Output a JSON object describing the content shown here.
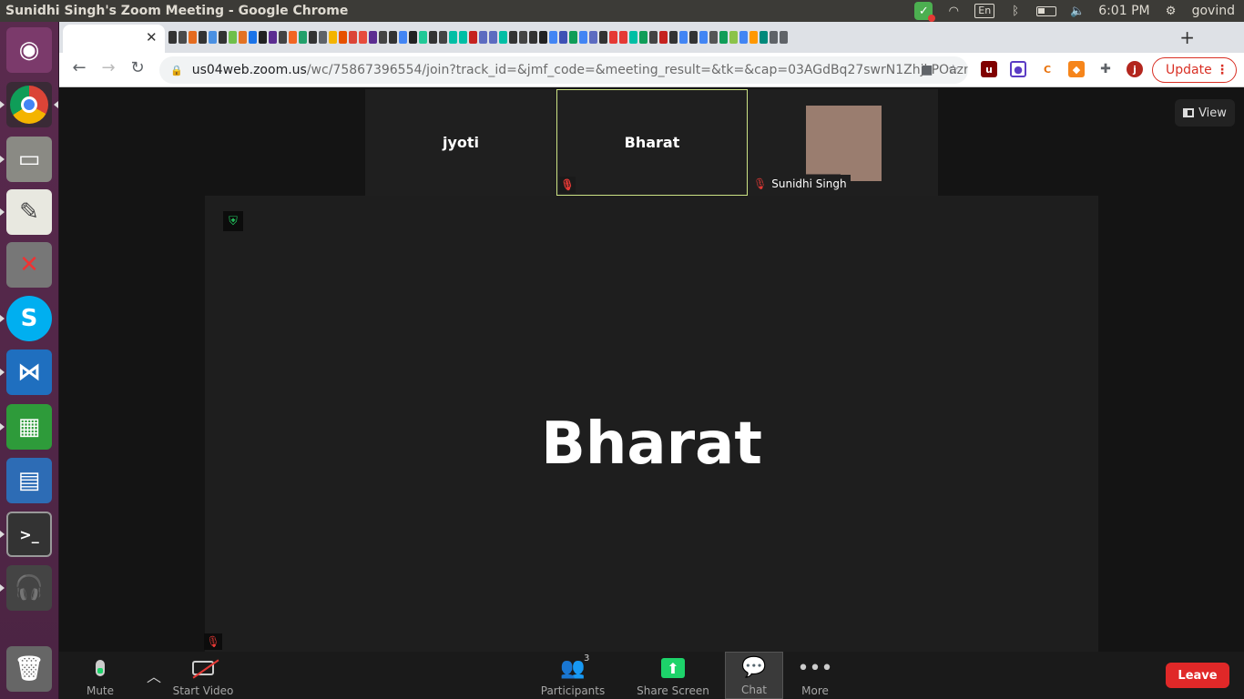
{
  "window": {
    "title": "Sunidhi Singh's Zoom Meeting - Google Chrome"
  },
  "tray": {
    "language": "En",
    "time": "6:01 PM",
    "user": "govind"
  },
  "browser": {
    "url_host": "us04web.zoom.us",
    "url_path": "/wc/75867396554/join?track_id=&jmf_code=&meeting_result=&tk=&cap=03AGdBq27swrN1ZhjkPOazrN...",
    "update_label": "Update",
    "profile_initial": "j"
  },
  "meeting": {
    "view_label": "View",
    "gallery": [
      {
        "name": "jyoti"
      },
      {
        "name": "Bharat"
      },
      {
        "name": "Sunidhi Singh"
      }
    ],
    "active_speaker": "Bharat"
  },
  "controls": {
    "mute_label": "Mute",
    "video_label": "Start Video",
    "participants_label": "Participants",
    "participants_count": "3",
    "share_label": "Share Screen",
    "chat_label": "Chat",
    "more_label": "More",
    "leave_label": "Leave"
  },
  "colors": {
    "leave": "#e02828",
    "share": "#1dd36a",
    "active_tile_border": "#cde485",
    "muted": "#e53935"
  }
}
